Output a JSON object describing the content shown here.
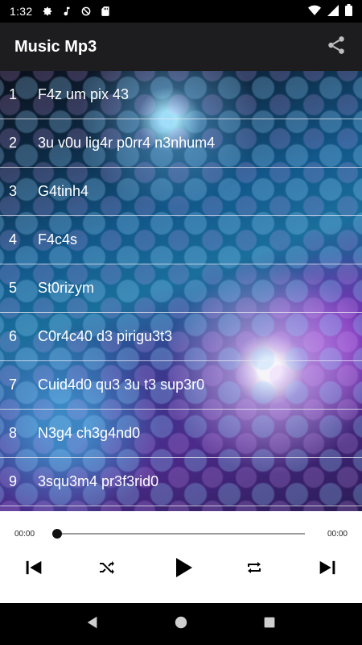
{
  "status_bar": {
    "time": "1:32",
    "left_icons": [
      "gear-icon",
      "music-note-icon",
      "data-saver-icon",
      "sd-card-icon"
    ],
    "right_icons": [
      "wifi-icon",
      "signal-icon",
      "battery-icon"
    ]
  },
  "app_bar": {
    "title": "Music Mp3",
    "share_icon": "share-icon"
  },
  "songs": [
    {
      "number": "1",
      "title": "F4z um pix 43"
    },
    {
      "number": "2",
      "title": "3u v0u lig4r p0rr4 n3nhum4"
    },
    {
      "number": "3",
      "title": "G4tinh4"
    },
    {
      "number": "4",
      "title": "F4c4s"
    },
    {
      "number": "5",
      "title": "St0rizym"
    },
    {
      "number": "6",
      "title": "C0r4c40 d3 pirigu3t3"
    },
    {
      "number": "7",
      "title": "Cuid4d0 qu3 3u t3 sup3r0"
    },
    {
      "number": "8",
      "title": "N3g4 ch3g4nd0"
    },
    {
      "number": "9",
      "title": "3squ3m4 pr3f3rid0"
    }
  ],
  "player": {
    "current_time": "00:00",
    "total_time": "00:00",
    "progress": 0,
    "controls": [
      "skip-previous-icon",
      "shuffle-icon",
      "play-icon",
      "repeat-icon",
      "skip-next-icon"
    ]
  },
  "nav_bar": {
    "buttons": [
      "back-icon",
      "home-icon",
      "recents-icon"
    ]
  },
  "colors": {
    "app_bar_bg": "#1d1d1f",
    "player_bg": "#ffffff",
    "divider": "#ebebf5"
  }
}
